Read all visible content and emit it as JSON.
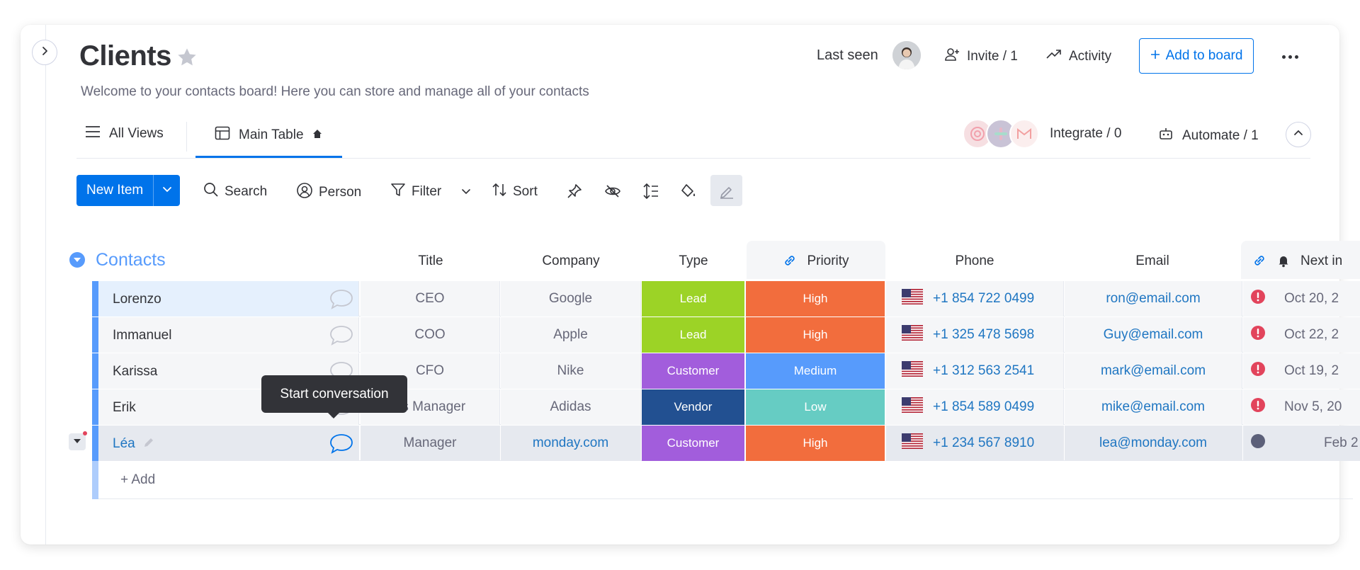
{
  "header": {
    "title": "Clients",
    "description": "Welcome to your contacts board! Here you can store and manage all of your contacts",
    "last_seen": "Last seen",
    "invite": "Invite / 1",
    "activity": "Activity",
    "add_to_board": "Add to board"
  },
  "tabs": {
    "all_views": "All Views",
    "main_table": "Main Table",
    "integrate": "Integrate / 0",
    "automate": "Automate / 1"
  },
  "toolbar": {
    "new_item": "New Item",
    "search": "Search",
    "person": "Person",
    "filter": "Filter",
    "sort": "Sort"
  },
  "group": {
    "title": "Contacts",
    "columns": [
      "Title",
      "Company",
      "Type",
      "Priority",
      "Phone",
      "Email",
      "Next in"
    ],
    "add_label": "+ Add"
  },
  "rows": [
    {
      "name": "Lorenzo",
      "title": "CEO",
      "company": "Google",
      "type": "Lead",
      "priority": "High",
      "phone": "+1 854 722 0499",
      "email": "ron@email.com",
      "date": "Oct 20, 2"
    },
    {
      "name": "Immanuel",
      "title": "COO",
      "company": "Apple",
      "type": "Lead",
      "priority": "High",
      "phone": "+1 325 478 5698",
      "email": "Guy@email.com",
      "date": "Oct 22, 2"
    },
    {
      "name": "Karissa",
      "title": "CFO",
      "company": "Nike",
      "type": "Customer",
      "priority": "Medium",
      "phone": "+1 312 563 2541",
      "email": "mark@email.com",
      "date": "Oct 19, 2"
    },
    {
      "name": "Erik",
      "title": "es Manager",
      "company": "Adidas",
      "type": "Vendor",
      "priority": "Low",
      "phone": "+1 854 589 0499",
      "email": "mike@email.com",
      "date": "Nov 5, 20"
    },
    {
      "name": "Léa",
      "title": "Manager",
      "company": "monday.com",
      "type": "Customer",
      "priority": "High",
      "phone": "+1 234 567 8910",
      "email": "lea@monday.com",
      "date": "Feb 2"
    }
  ],
  "tooltip": "Start conversation",
  "colors": {
    "accent": "#0073ea",
    "group": "#579bfc",
    "lead": "#9cd326",
    "customer": "#a25ddc",
    "vendor": "#225091",
    "high": "#f26d3d",
    "medium": "#579bfc",
    "low": "#66ccc3",
    "alert": "#e2445c"
  }
}
